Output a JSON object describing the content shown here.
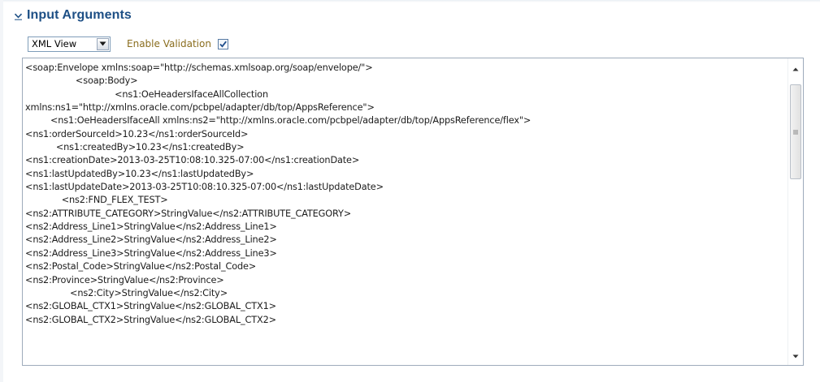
{
  "section": {
    "title": "Input Arguments",
    "expanded": true
  },
  "toolbar": {
    "view_select": {
      "value": "XML View"
    },
    "validation_label": "Enable Validation",
    "validation_checked": true
  },
  "xml_lines": [
    "<soap:Envelope xmlns:soap=\"http://schemas.xmlsoap.org/soap/envelope/\">",
    "                  <soap:Body>",
    "                                <ns1:OeHeadersIfaceAllCollection",
    "xmlns:ns1=\"http://xmlns.oracle.com/pcbpel/adapter/db/top/AppsReference\">",
    "         <ns1:OeHeadersIfaceAll xmlns:ns2=\"http://xmlns.oracle.com/pcbpel/adapter/db/top/AppsReference/flex\">",
    "<ns1:orderSourceId>10.23</ns1:orderSourceId>",
    "           <ns1:createdBy>10.23</ns1:createdBy>",
    "<ns1:creationDate>2013-03-25T10:08:10.325-07:00</ns1:creationDate>",
    "<ns1:lastUpdatedBy>10.23</ns1:lastUpdatedBy>",
    "<ns1:lastUpdateDate>2013-03-25T10:08:10.325-07:00</ns1:lastUpdateDate>",
    "             <ns2:FND_FLEX_TEST>",
    "<ns2:ATTRIBUTE_CATEGORY>StringValue</ns2:ATTRIBUTE_CATEGORY>",
    "<ns2:Address_Line1>StringValue</ns2:Address_Line1>",
    "<ns2:Address_Line2>StringValue</ns2:Address_Line2>",
    "<ns2:Address_Line3>StringValue</ns2:Address_Line3>",
    "<ns2:Postal_Code>StringValue</ns2:Postal_Code>",
    "<ns2:Province>StringValue</ns2:Province>",
    "                <ns2:City>StringValue</ns2:City>",
    "<ns2:GLOBAL_CTX1>StringValue</ns2:GLOBAL_CTX1>",
    "<ns2:GLOBAL_CTX2>StringValue</ns2:GLOBAL_CTX2>"
  ],
  "colors": {
    "title": "#1d4f85",
    "label": "#8a6d1e",
    "border": "#9eabbb",
    "check": "#1f4e8c"
  },
  "icons": {
    "disclosure": "chevron-down-icon",
    "select_arrow": "caret-down-icon",
    "checkbox_mark": "checkmark-icon",
    "scroll_up": "scroll-up-icon",
    "scroll_down": "scroll-down-icon",
    "scroll_grip": "grip-icon"
  }
}
